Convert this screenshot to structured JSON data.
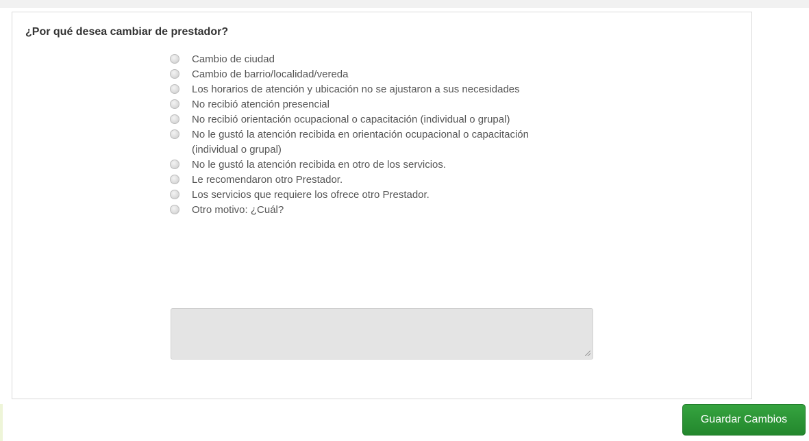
{
  "form": {
    "question": "¿Por qué desea cambiar de prestador?",
    "options": [
      "Cambio de ciudad",
      "Cambio de barrio/localidad/vereda",
      "Los horarios de atención y ubicación no se ajustaron a sus necesidades",
      "No recibió atención presencial",
      "No recibió orientación ocupacional o capacitación (individual o grupal)",
      "No le gustó la atención recibida en orientación ocupacional o capacitación (individual o grupal)",
      "No le gustó la atención recibida en otro de los servicios.",
      "Le recomendaron otro Prestador.",
      "Los servicios que requiere los ofrece otro Prestador.",
      "Otro motivo: ¿Cuál?"
    ],
    "other_reason_value": ""
  },
  "actions": {
    "save_label": "Guardar Cambios"
  }
}
